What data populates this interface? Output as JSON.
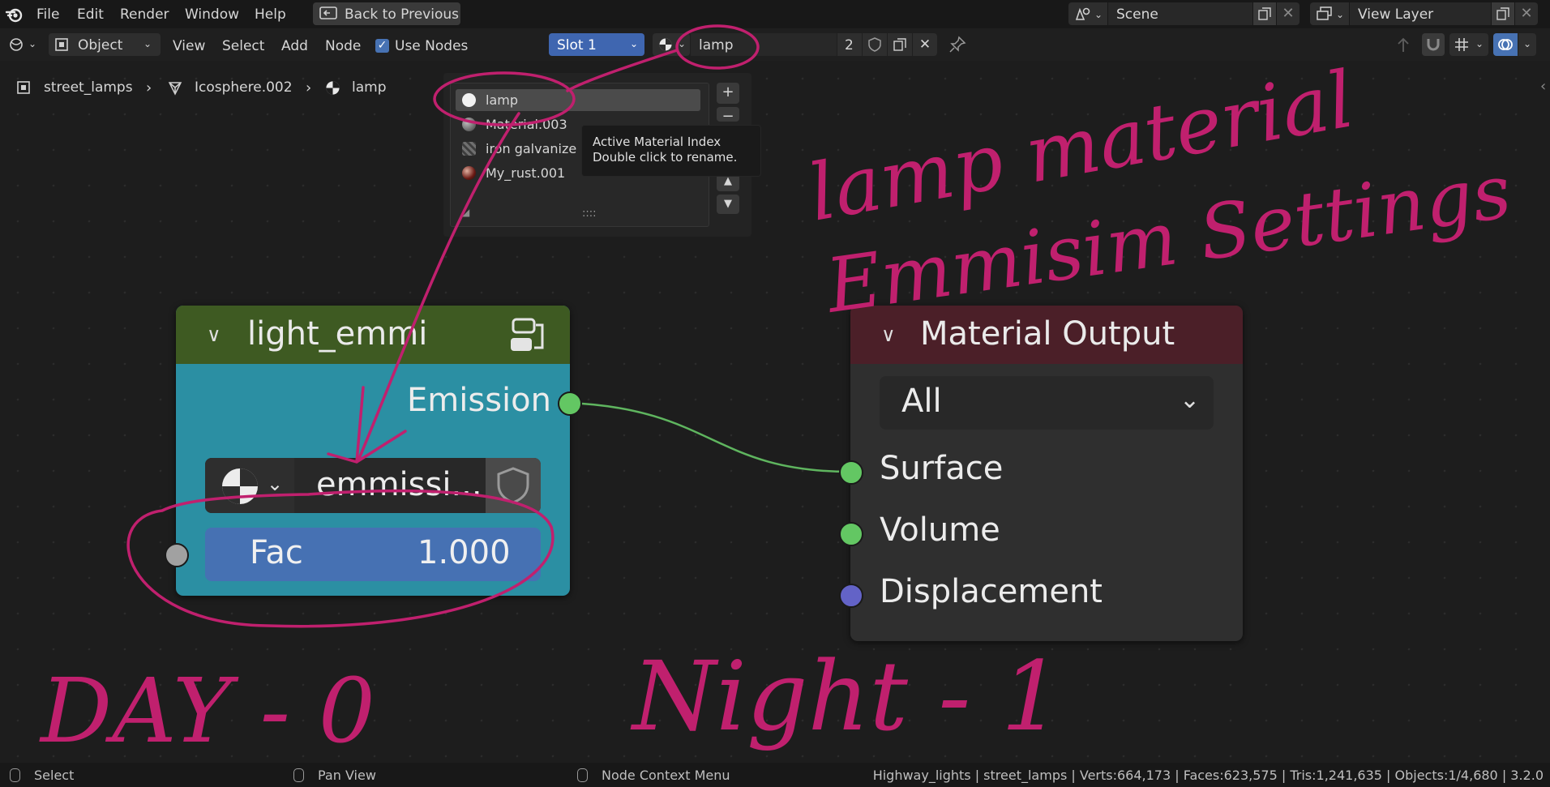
{
  "menubar": {
    "items": [
      "File",
      "Edit",
      "Render",
      "Window",
      "Help"
    ],
    "back_button": "Back to Previous",
    "scene_label": "Scene",
    "view_layer_label": "View Layer"
  },
  "header": {
    "mode": "Object",
    "menus": [
      "View",
      "Select",
      "Add",
      "Node"
    ],
    "use_nodes_label": "Use Nodes",
    "use_nodes_checked": true,
    "slot": "Slot 1",
    "material_name": "lamp",
    "user_count": "2"
  },
  "breadcrumb": {
    "object": "street_lamps",
    "mesh": "Icosphere.002",
    "material": "lamp"
  },
  "material_popup": {
    "items": [
      {
        "label": "lamp",
        "icon": "white-sphere-icon",
        "selected": true
      },
      {
        "label": "Material.003",
        "icon": "grey-sphere-icon",
        "selected": false
      },
      {
        "label": "iron galvanized",
        "icon": "metal-texture-icon",
        "selected": false
      },
      {
        "label": "My_rust.001",
        "icon": "rust-sphere-icon",
        "selected": false
      }
    ],
    "add_label": "+",
    "remove_label": "−",
    "up_label": "▲",
    "down_label": "▼",
    "grip_label": "::::"
  },
  "tooltip": {
    "line1": "Active Material Index",
    "line2": "Double click to rename."
  },
  "node_light": {
    "title": "light_emmi",
    "output_label": "Emission",
    "datablock_label": "emmissi...",
    "fac_label": "Fac",
    "fac_value": "1.000"
  },
  "node_output": {
    "title": "Material Output",
    "target": "All",
    "inputs": [
      "Surface",
      "Volume",
      "Displacement"
    ]
  },
  "annotations": {
    "line1": "lamp material",
    "line2": "Emmisim Settings",
    "day": "DAY - 0",
    "night": "Night - 1"
  },
  "statusbar": {
    "select": "Select",
    "pan": "Pan View",
    "context": "Node Context Menu",
    "stats": "Highway_lights | street_lamps | Verts:664,173 | Faces:623,575 | Tris:1,241,635 | Objects:1/4,680 | 3.2.0"
  },
  "colors": {
    "annotation": "#c0206e",
    "slot_blue": "#3f66b0",
    "socket_green": "#63c763",
    "socket_purple": "#6363c7",
    "socket_grey": "#a1a1a1",
    "link_green": "#5fb55f"
  }
}
